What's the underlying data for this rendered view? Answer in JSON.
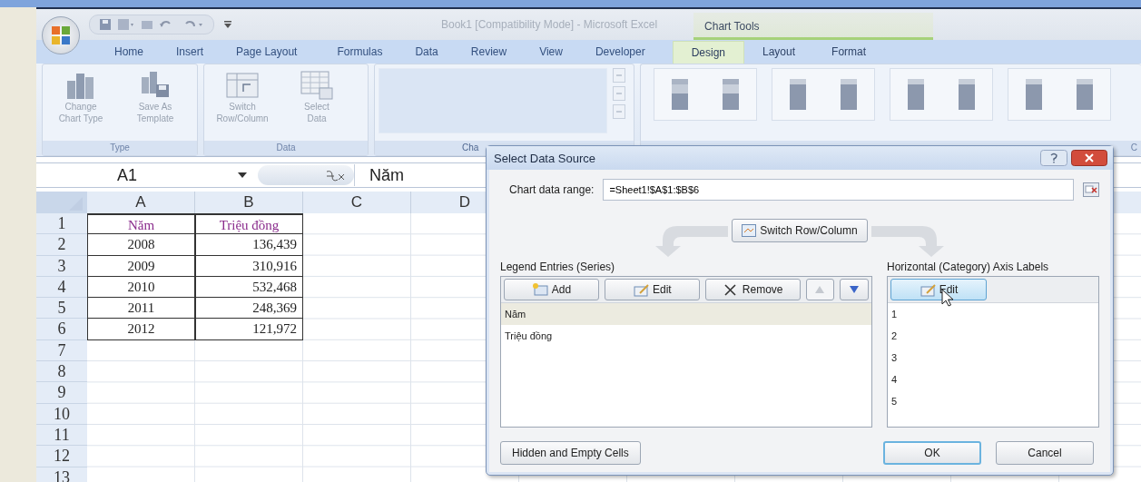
{
  "title_bar": {
    "title": "Book1  [Compatibility Mode]  -  Microsoft Excel",
    "contextual_label": "Chart Tools"
  },
  "tabs": [
    {
      "label": "Home",
      "selected": false,
      "contextual": false
    },
    {
      "label": "Insert",
      "selected": false,
      "contextual": false
    },
    {
      "label": "Page Layout",
      "selected": false,
      "contextual": false
    },
    {
      "label": "Formulas",
      "selected": false,
      "contextual": false
    },
    {
      "label": "Data",
      "selected": false,
      "contextual": false
    },
    {
      "label": "Review",
      "selected": false,
      "contextual": false
    },
    {
      "label": "View",
      "selected": false,
      "contextual": false
    },
    {
      "label": "Developer",
      "selected": false,
      "contextual": false
    },
    {
      "label": "Design",
      "selected": true,
      "contextual": true
    },
    {
      "label": "Layout",
      "selected": false,
      "contextual": true
    },
    {
      "label": "Format",
      "selected": false,
      "contextual": true
    }
  ],
  "ribbon": {
    "groups": [
      {
        "kind": "buttons",
        "label": "Type",
        "buttons": [
          {
            "kind": "chart-type",
            "label": "Change\nChart Type"
          },
          {
            "kind": "template",
            "label": "Save As\nTemplate"
          }
        ]
      },
      {
        "kind": "buttons",
        "label": "Data",
        "buttons": [
          {
            "kind": "switch",
            "label": "Switch\nRow/Column"
          },
          {
            "kind": "select",
            "label": "Select\nData"
          }
        ]
      },
      {
        "kind": "layouts",
        "label": "Cha"
      },
      {
        "kind": "styles",
        "label": "C"
      }
    ]
  },
  "formula_bar": {
    "name_box": "A1",
    "value": "Năm"
  },
  "sheet": {
    "columns": [
      "A",
      "B",
      "C",
      "D"
    ],
    "rows": [
      {
        "number": "1",
        "cells": [
          "Năm",
          "Triệu đồng"
        ]
      },
      {
        "number": "2",
        "cells": [
          "2008",
          "136,439"
        ]
      },
      {
        "number": "3",
        "cells": [
          "2009",
          "310,916"
        ]
      },
      {
        "number": "4",
        "cells": [
          "2010",
          "532,468"
        ]
      },
      {
        "number": "5",
        "cells": [
          "2011",
          "248,369"
        ]
      },
      {
        "number": "6",
        "cells": [
          "2012",
          "121,972"
        ]
      },
      {
        "number": "7",
        "cells": []
      },
      {
        "number": "8",
        "cells": []
      },
      {
        "number": "9",
        "cells": []
      },
      {
        "number": "10",
        "cells": []
      },
      {
        "number": "11",
        "cells": []
      },
      {
        "number": "12",
        "cells": []
      },
      {
        "number": "13",
        "cells": []
      }
    ]
  },
  "dialog": {
    "title": "Select Data Source",
    "range_label": "Chart data range:",
    "range_value": "=Sheet1!$A$1:$B$6",
    "switch_button": "Switch Row/Column",
    "legend_label": "Legend Entries (Series)",
    "legend_buttons": [
      {
        "kind": "add",
        "label": "Add",
        "disabled": false
      },
      {
        "kind": "edit",
        "label": "Edit",
        "disabled": false
      },
      {
        "kind": "remove",
        "label": "Remove",
        "disabled": false
      },
      {
        "kind": "up",
        "disabled": true
      },
      {
        "kind": "down",
        "disabled": false
      }
    ],
    "legend_items": [
      {
        "label": "Năm",
        "selected": true
      },
      {
        "label": "Triệu đồng",
        "selected": false
      }
    ],
    "axis_label": "Horizontal (Category) Axis Labels",
    "axis_button": {
      "label": "Edit",
      "hovered": true
    },
    "axis_items": [
      {
        "label": "1"
      },
      {
        "label": "2"
      },
      {
        "label": "3"
      },
      {
        "label": "4"
      },
      {
        "label": "5"
      }
    ],
    "hidden_button": "Hidden and Empty Cells",
    "ok_button": {
      "label": "OK",
      "focused": true
    },
    "cancel_button": {
      "label": "Cancel",
      "focused": false
    }
  }
}
